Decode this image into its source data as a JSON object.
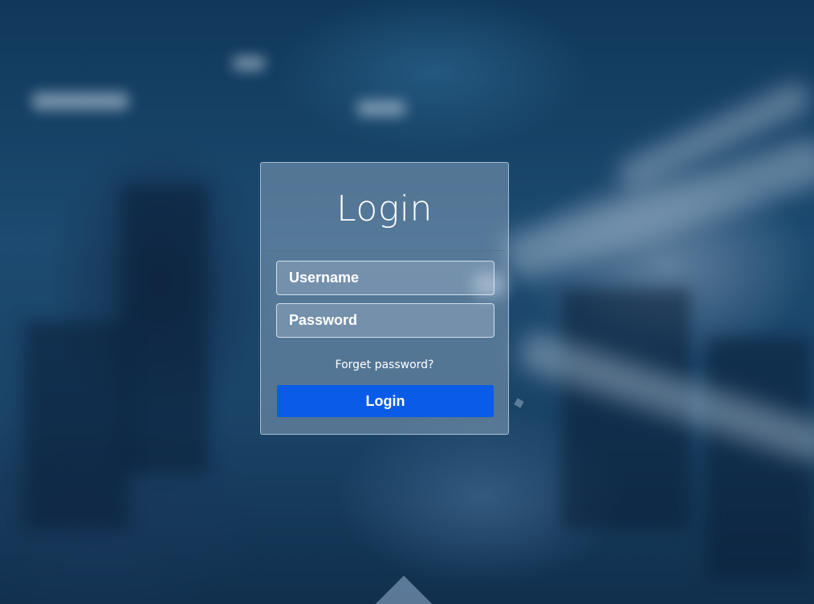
{
  "login_card": {
    "title": "Login",
    "username_placeholder": "Username",
    "password_placeholder": "Password",
    "forgot_link": "Forget password?",
    "login_button": "Login"
  },
  "colors": {
    "button_bg": "#0a5ce8",
    "text": "#ffffff",
    "background": "#123a5a"
  }
}
